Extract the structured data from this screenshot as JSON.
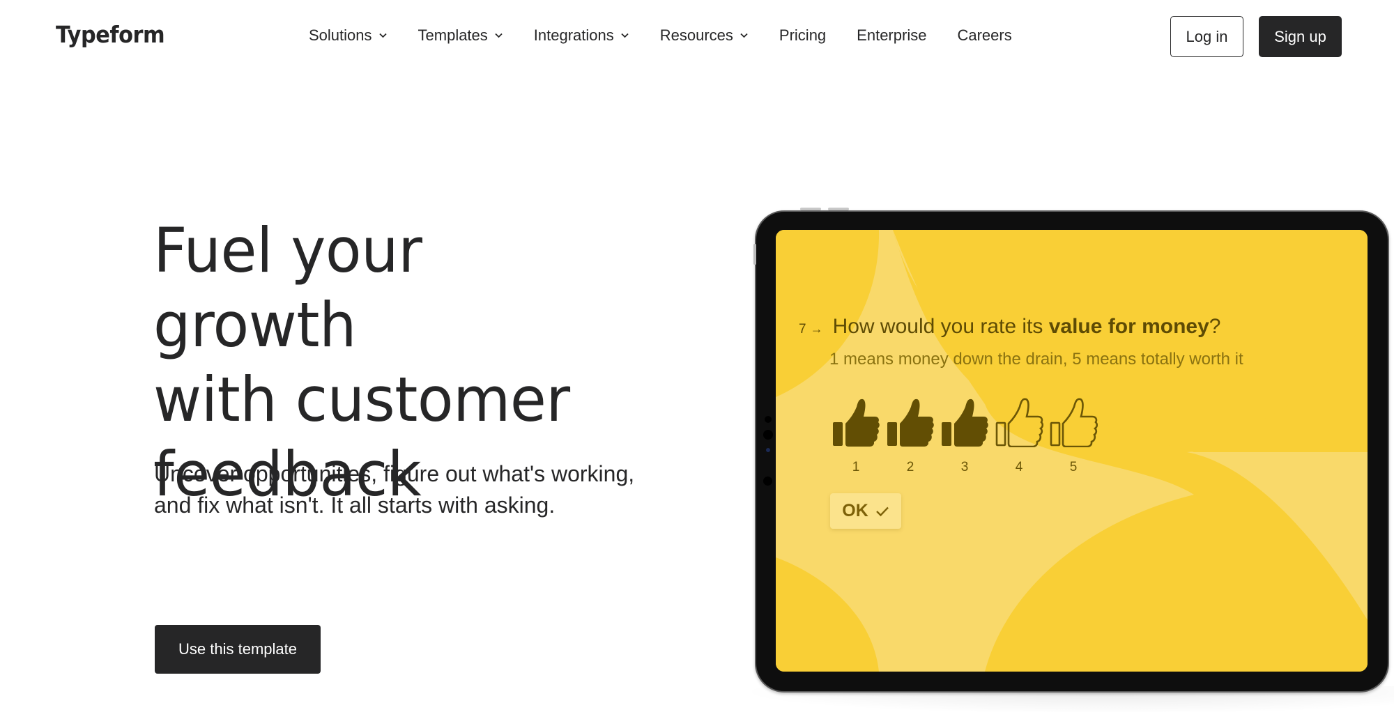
{
  "header": {
    "logo": "Typeform",
    "nav": [
      {
        "label": "Solutions",
        "has_dropdown": true
      },
      {
        "label": "Templates",
        "has_dropdown": true
      },
      {
        "label": "Integrations",
        "has_dropdown": true
      },
      {
        "label": "Resources",
        "has_dropdown": true
      },
      {
        "label": "Pricing",
        "has_dropdown": false
      },
      {
        "label": "Enterprise",
        "has_dropdown": false
      },
      {
        "label": "Careers",
        "has_dropdown": false
      }
    ],
    "login_label": "Log in",
    "signup_label": "Sign up"
  },
  "hero": {
    "title_lines": [
      "Fuel your growth",
      "with customer",
      "feedback"
    ],
    "subtitle_lines": [
      "Uncover opportunities, figure out what's working,",
      "and fix what isn't. It all starts with asking."
    ],
    "cta_label": "Use this template"
  },
  "tablet": {
    "screen_color": "#f9cf36",
    "question": {
      "number": "7",
      "arrow_icon": "arrow-right-icon",
      "text_before": "How would you rate its ",
      "text_bold": "value for money",
      "text_after": "?",
      "description": "1 means money down the drain, 5 means totally worth it"
    },
    "rating": {
      "selected": 3,
      "max": 5,
      "icon": "thumbs-up-icon",
      "labels": [
        "1",
        "2",
        "3",
        "4",
        "5"
      ]
    },
    "ok_label": "OK",
    "ok_icon": "checkmark-icon"
  },
  "colors": {
    "primary_dark": "#262627",
    "accent_yellow": "#f9cf36",
    "rating_brown": "#5e4b04"
  }
}
